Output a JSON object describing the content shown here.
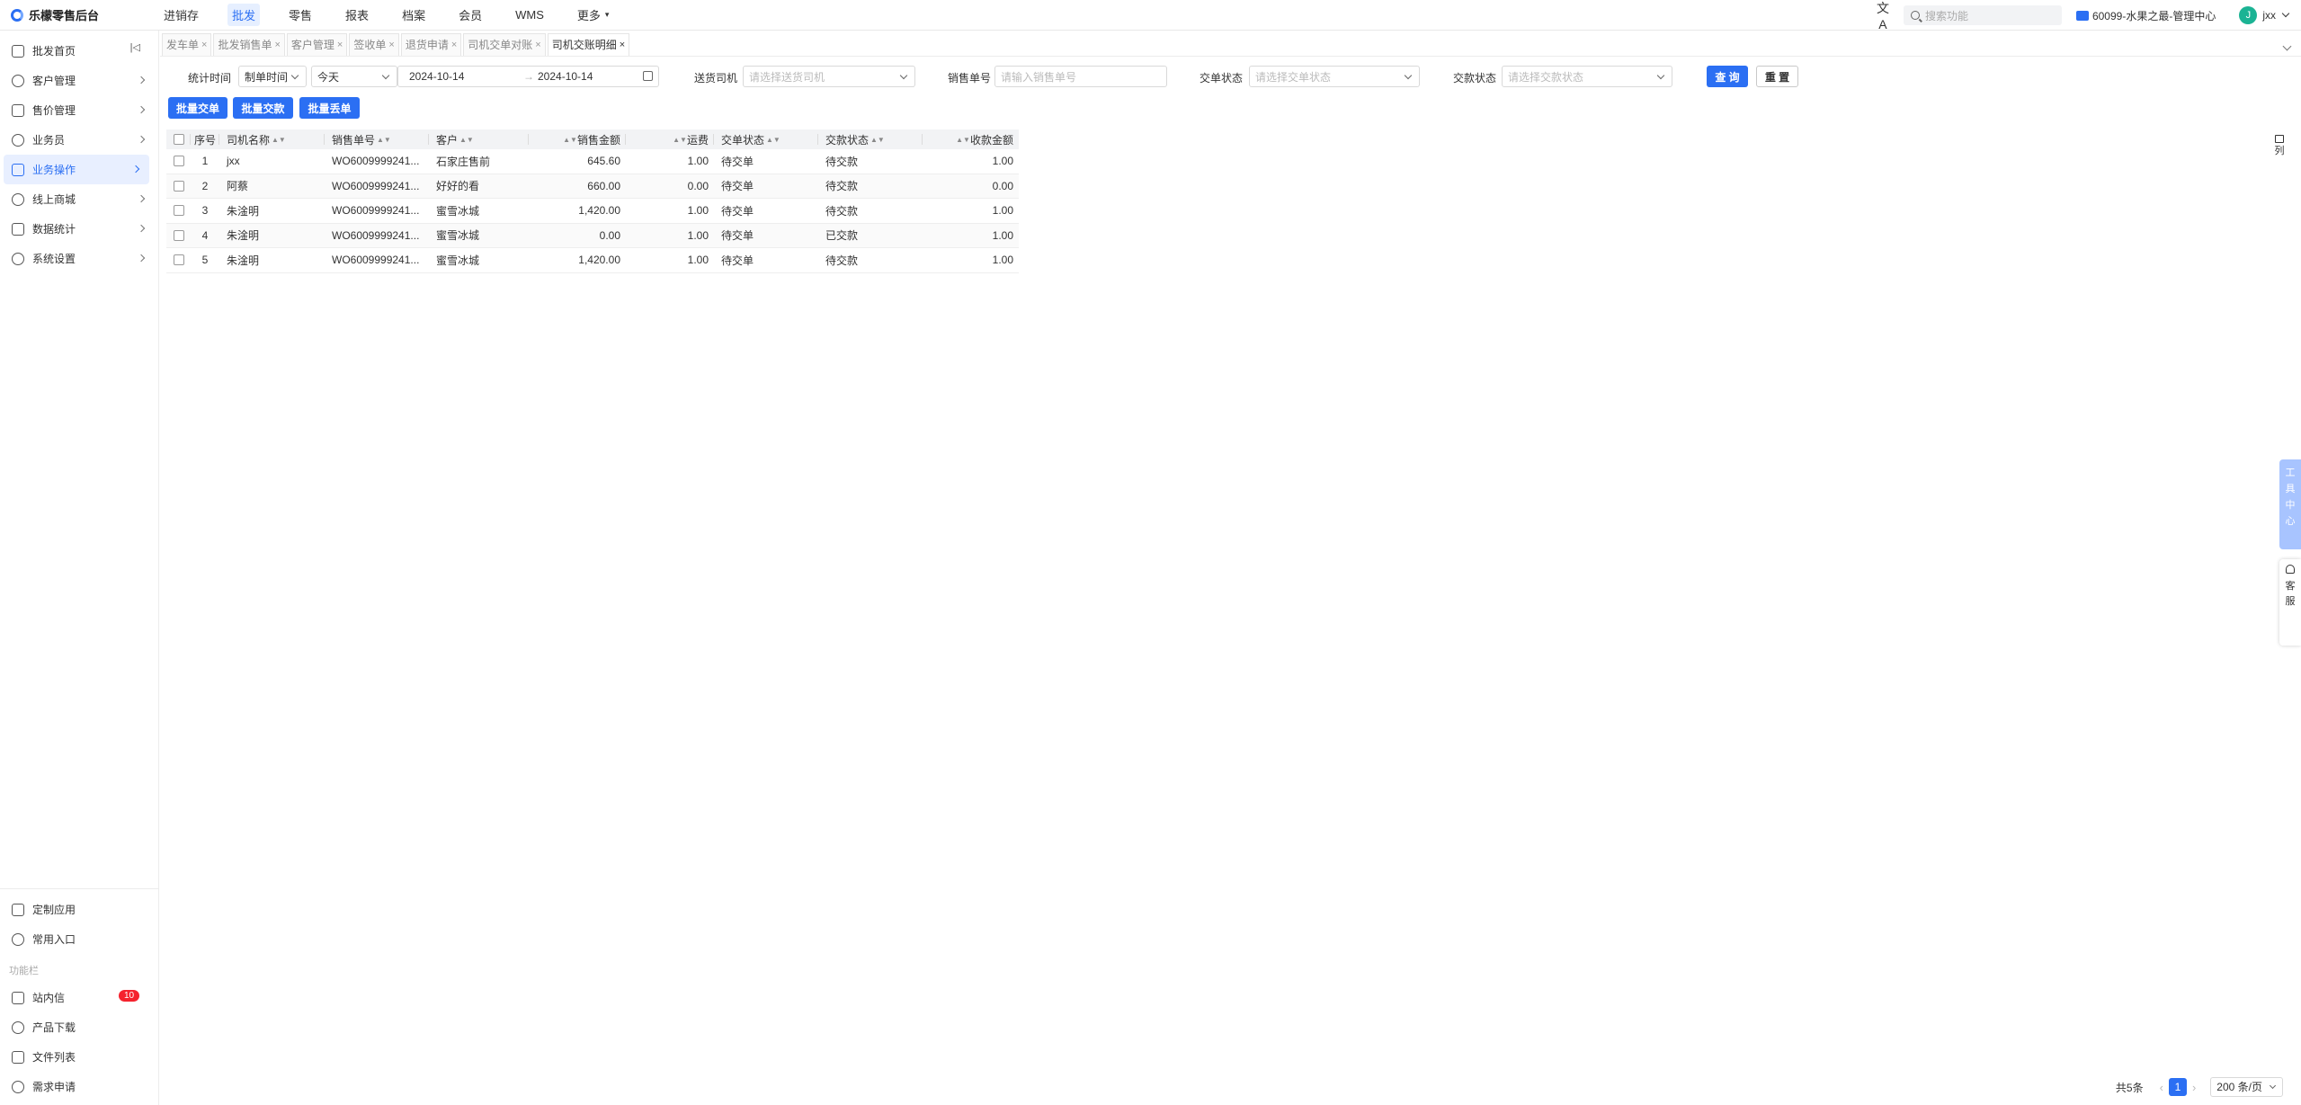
{
  "app": {
    "title": "乐檬零售后台"
  },
  "topnav": {
    "items": [
      {
        "label": "进销存",
        "active": false
      },
      {
        "label": "批发",
        "active": true
      },
      {
        "label": "零售",
        "active": false
      },
      {
        "label": "报表",
        "active": false
      },
      {
        "label": "档案",
        "active": false
      },
      {
        "label": "会员",
        "active": false
      },
      {
        "label": "WMS",
        "active": false
      },
      {
        "label": "更多",
        "active": false
      }
    ],
    "search_placeholder": "搜索功能",
    "shop": "60099-水果之最-管理中心",
    "user_initial": "J",
    "user_name": "jxx"
  },
  "sidebar": {
    "items": [
      {
        "label": "批发首页",
        "icon": "home-icon"
      },
      {
        "label": "客户管理",
        "icon": "user-icon"
      },
      {
        "label": "售价管理",
        "icon": "price-icon"
      },
      {
        "label": "业务员",
        "icon": "person-icon"
      },
      {
        "label": "业务操作",
        "icon": "operation-icon",
        "active": true
      },
      {
        "label": "线上商城",
        "icon": "shop-icon"
      },
      {
        "label": "数据统计",
        "icon": "chart-icon"
      },
      {
        "label": "系统设置",
        "icon": "settings-icon"
      }
    ],
    "bottom_items": [
      {
        "label": "定制应用",
        "icon": "custom-app-icon"
      },
      {
        "label": "常用入口",
        "icon": "heart-icon"
      }
    ],
    "section_label": "功能栏",
    "tools": [
      {
        "label": "站内信",
        "icon": "mail-icon",
        "badge": "10"
      },
      {
        "label": "产品下载",
        "icon": "download-icon"
      },
      {
        "label": "文件列表",
        "icon": "file-icon"
      },
      {
        "label": "需求申请",
        "icon": "request-icon"
      }
    ]
  },
  "tabs": [
    {
      "label": "发车单",
      "active": false
    },
    {
      "label": "批发销售单",
      "active": false
    },
    {
      "label": "客户管理",
      "active": false
    },
    {
      "label": "签收单",
      "active": false
    },
    {
      "label": "退货申请",
      "active": false
    },
    {
      "label": "司机交单对账",
      "active": false
    },
    {
      "label": "司机交账明细",
      "active": true
    }
  ],
  "filters": {
    "stat_time_label": "统计时间",
    "time_type": "制单时间",
    "period": "今天",
    "date_start": "2024-10-14",
    "date_sep": "→",
    "date_end": "2024-10-14",
    "driver_label": "送货司机",
    "driver_placeholder": "请选择送货司机",
    "order_no_label": "销售单号",
    "order_no_placeholder": "请输入销售单号",
    "submit_status_label": "交单状态",
    "submit_status_placeholder": "请选择交单状态",
    "payment_status_label": "交款状态",
    "payment_status_placeholder": "请选择交款状态",
    "query_button": "查 询",
    "reset_button": "重 置"
  },
  "actions": {
    "batch_submit": "批量交单",
    "batch_payment": "批量交款",
    "batch_lost": "批量丢单"
  },
  "table": {
    "headers": [
      "序号",
      "司机名称",
      "销售单号",
      "客户",
      "销售金额",
      "运费",
      "交单状态",
      "交款状态",
      "收款金额"
    ],
    "rows": [
      {
        "seq": "1",
        "driver": "jxx",
        "order": "WO6009999241...",
        "customer": "石家庄售前",
        "amount": "645.60",
        "freight": "1.00",
        "submit": "待交单",
        "payment": "待交款",
        "received": "1.00"
      },
      {
        "seq": "2",
        "driver": "阿蔡",
        "order": "WO6009999241...",
        "customer": "好好的看",
        "amount": "660.00",
        "freight": "0.00",
        "submit": "待交单",
        "payment": "待交款",
        "received": "0.00"
      },
      {
        "seq": "3",
        "driver": "朱淦明",
        "order": "WO6009999241...",
        "customer": "蜜雪冰城",
        "amount": "1,420.00",
        "freight": "1.00",
        "submit": "待交单",
        "payment": "待交款",
        "received": "1.00"
      },
      {
        "seq": "4",
        "driver": "朱淦明",
        "order": "WO6009999241...",
        "customer": "蜜雪冰城",
        "amount": "0.00",
        "freight": "1.00",
        "submit": "待交单",
        "payment": "已交款",
        "received": "1.00"
      },
      {
        "seq": "5",
        "driver": "朱淦明",
        "order": "WO6009999241...",
        "customer": "蜜雪冰城",
        "amount": "1,420.00",
        "freight": "1.00",
        "submit": "待交单",
        "payment": "待交款",
        "received": "1.00"
      }
    ],
    "column_setting": "列"
  },
  "floating": {
    "tools_label": "工具中心",
    "service_label": "客服"
  },
  "pager": {
    "total": "共5条",
    "current_page": "1",
    "page_size": "200 条/页"
  }
}
